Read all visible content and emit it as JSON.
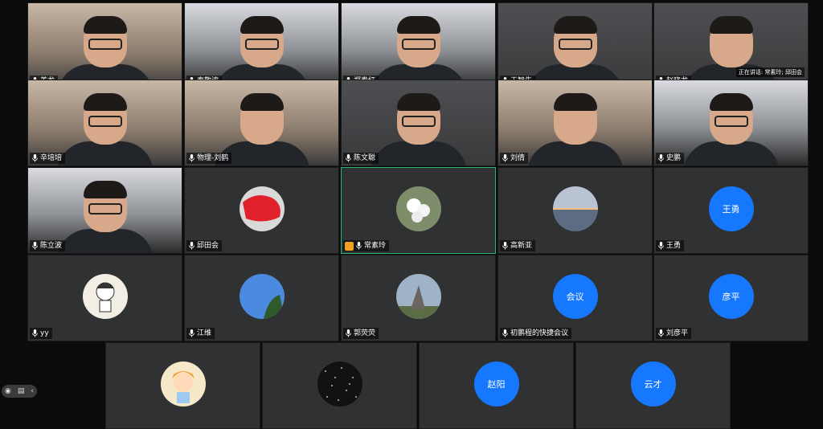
{
  "speaking_banner": "正在讲话: 常素玲; 邱田会",
  "rows": [
    [
      {
        "name": "姜龙",
        "kind": "video",
        "tone": "warm",
        "glasses": true
      },
      {
        "name": "秦敬波",
        "kind": "video",
        "tone": "cool",
        "glasses": true
      },
      {
        "name": "郑春红",
        "kind": "video",
        "tone": "cool",
        "glasses": true
      },
      {
        "name": "于智先",
        "kind": "video",
        "tone": "dark",
        "glasses": true
      },
      {
        "name": "赵晓龙",
        "kind": "video",
        "tone": "dark",
        "glasses": false
      }
    ],
    [
      {
        "name": "辛培培",
        "kind": "video",
        "tone": "warm",
        "glasses": true
      },
      {
        "name": "物理-刘鹤",
        "kind": "video",
        "tone": "warm",
        "glasses": false
      },
      {
        "name": "陈文聪",
        "kind": "video",
        "tone": "dark",
        "glasses": true
      },
      {
        "name": "刘倩",
        "kind": "video",
        "tone": "warm",
        "glasses": false
      },
      {
        "name": "史鹏",
        "kind": "video",
        "tone": "cool",
        "glasses": true
      }
    ],
    [
      {
        "name": "陈立波",
        "kind": "video",
        "tone": "cool",
        "glasses": true
      },
      {
        "name": "邱田会",
        "kind": "avatar",
        "avatar": "red-photo"
      },
      {
        "name": "常素玲",
        "kind": "avatar",
        "avatar": "flower-photo",
        "host": true,
        "active": true
      },
      {
        "name": "高新亚",
        "kind": "avatar",
        "avatar": "sunset-photo"
      },
      {
        "name": "王勇",
        "kind": "initials",
        "initials": "王勇"
      }
    ],
    [
      {
        "name": "yy",
        "kind": "avatar",
        "avatar": "cartoon-photo"
      },
      {
        "name": "江维",
        "kind": "avatar",
        "avatar": "sky-photo"
      },
      {
        "name": "郭荧荧",
        "kind": "avatar",
        "avatar": "tower-photo"
      },
      {
        "name": "初鹏程的快捷会议",
        "kind": "initials",
        "initials": "会议"
      },
      {
        "name": "刘彦平",
        "kind": "initials",
        "initials": "彦平"
      }
    ],
    [
      {
        "name": "",
        "kind": "avatar",
        "avatar": "girl-cartoon-photo"
      },
      {
        "name": "",
        "kind": "avatar",
        "avatar": "noise-photo"
      },
      {
        "name": "",
        "kind": "initials",
        "initials": "赵阳"
      },
      {
        "name": "",
        "kind": "initials",
        "initials": "云才"
      }
    ]
  ],
  "colors": {
    "accent_blue": "#1677ff",
    "active_border": "#2bb673",
    "tile_bg": "#2f3133"
  }
}
